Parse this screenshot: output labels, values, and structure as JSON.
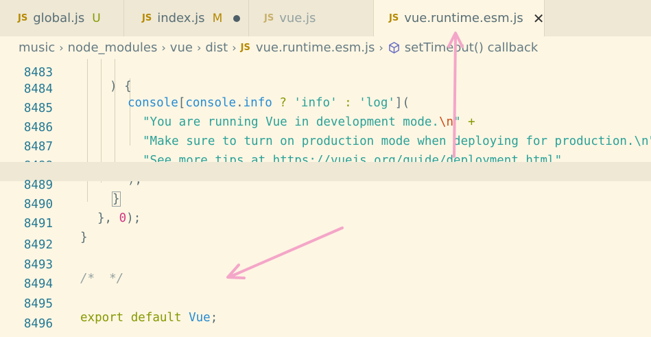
{
  "tabs": [
    {
      "name": "global.js",
      "status": "U",
      "name_color": "#586e75",
      "status_color": "#859900"
    },
    {
      "name": "index.js",
      "status": "M",
      "name_color": "#586e75",
      "status_color": "#b58900"
    },
    {
      "name": "vue.js",
      "status": "",
      "name_color": "#93a1a1"
    },
    {
      "name": "vue.runtime.esm.js",
      "status": "",
      "name_color": "#586e75",
      "active": true
    }
  ],
  "tab_icon_label": "JS",
  "breadcrumb": {
    "items": [
      "music",
      "node_modules",
      "vue",
      "dist",
      "vue.runtime.esm.js",
      "setTimeout() callback"
    ],
    "js_label": "JS"
  },
  "gutter": {
    "lines": [
      "8483",
      "8484",
      "8485",
      "8486",
      "8487",
      "8488",
      "8489",
      "8490",
      "8491",
      "8492",
      "8493",
      "8494",
      "8495",
      "8496"
    ]
  },
  "code": {
    "l8483": ") {",
    "l8484_a": "console",
    "l8484_b": "[",
    "l8484_c": "console",
    "l8484_d": ".",
    "l8484_e": "info",
    "l8484_f": " ? ",
    "l8484_g": "'info'",
    "l8484_h": " : ",
    "l8484_i": "'log'",
    "l8484_j": "](",
    "l8485_a": "\"You are running Vue in development mode.",
    "l8485_b": "\\n",
    "l8485_c": "\"",
    "l8485_d": " +",
    "l8486_a": "\"Make sure to turn on production mode when deploying for production.\\n\"",
    "l8486_b": " +",
    "l8487_a": "\"See more tips at ",
    "l8487_b": "https://vuejs.org/guide/deployment.html",
    "l8487_c": "\"",
    "l8488": ");",
    "l8489": "}",
    "l8490_a": "}, ",
    "l8490_b": "0",
    "l8490_c": ");",
    "l8491": "}",
    "l8493": "/*  */",
    "l8495_a": "export",
    "l8495_b": " ",
    "l8495_c": "default",
    "l8495_d": " ",
    "l8495_e": "Vue",
    "l8495_f": ";"
  },
  "colors": {
    "background": "#fdf6e3",
    "tab_bar": "#eee8d5",
    "arrow": "#f4a6c8",
    "js_icon": "#b58900"
  }
}
